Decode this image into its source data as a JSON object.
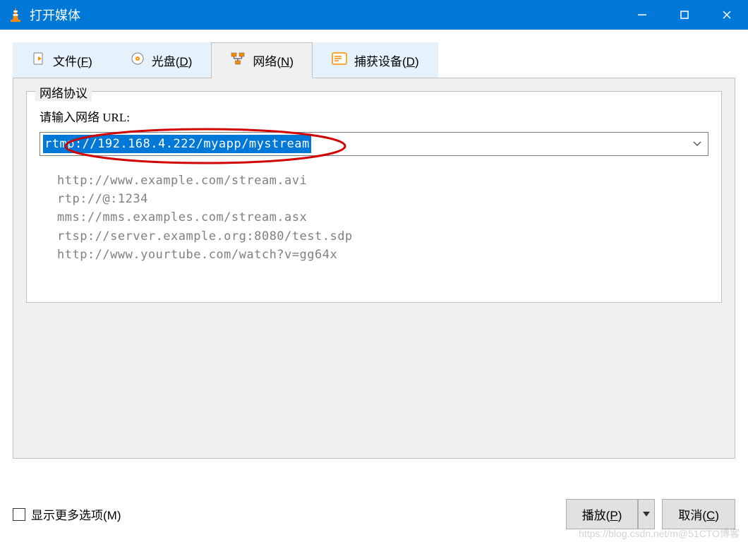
{
  "window": {
    "title": "打开媒体"
  },
  "tabs": [
    {
      "label_prefix": "文件(",
      "accel": "F",
      "label_suffix": ")"
    },
    {
      "label_prefix": "光盘(",
      "accel": "D",
      "label_suffix": ")"
    },
    {
      "label_prefix": "网络(",
      "accel": "N",
      "label_suffix": ")"
    },
    {
      "label_prefix": "捕获设备(",
      "accel": "D",
      "label_suffix": ")"
    }
  ],
  "network": {
    "fieldset_legend": "网络协议",
    "url_label": "请输入网络 URL:",
    "url_value": "rtmp://192.168.4.222/myapp/mystream",
    "examples": [
      "http://www.example.com/stream.avi",
      "rtp://@:1234",
      "mms://mms.examples.com/stream.asx",
      "rtsp://server.example.org:8080/test.sdp",
      "http://www.yourtube.com/watch?v=gg64x"
    ]
  },
  "options": {
    "show_more_prefix": "显示更多选项(",
    "show_more_accel": "M",
    "show_more_suffix": ")"
  },
  "buttons": {
    "play_prefix": "播放(",
    "play_accel": "P",
    "play_suffix": ")",
    "cancel_prefix": "取消(",
    "cancel_accel": "C",
    "cancel_suffix": ")"
  },
  "watermark": "https://blog.csdn.net/m@51CTO博客"
}
